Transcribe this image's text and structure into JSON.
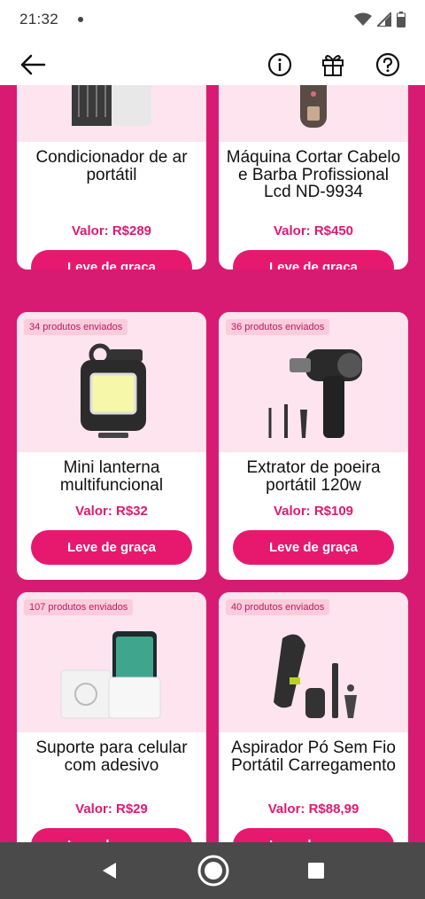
{
  "status_bar": {
    "time": "21:32"
  },
  "products": [
    {
      "title": "Condicionador de ar portátil",
      "price": "Valor: R$289",
      "button": "Leve de graça",
      "badge": "",
      "icon": "air-conditioner-image"
    },
    {
      "title": "Máquina Cortar Cabelo e Barba Profissional Lcd ND-9934",
      "price": "Valor: R$450",
      "button": "Leve de graça",
      "badge": "",
      "icon": "hair-clipper-image"
    },
    {
      "title": "Mini lanterna multifuncional",
      "price": "Valor: R$32",
      "button": "Leve de graça",
      "badge": "34 produtos enviados",
      "icon": "mini-flashlight-image"
    },
    {
      "title": "Extrator de poeira portátil 120w",
      "price": "Valor: R$109",
      "button": "Leve de graça",
      "badge": "36 produtos enviados",
      "icon": "dust-blower-image"
    },
    {
      "title": "Suporte para celular com adesivo",
      "price": "Valor: R$29",
      "button": "Leve de graça",
      "badge": "107 produtos enviados",
      "icon": "phone-holder-image"
    },
    {
      "title": "Aspirador Pó Sem Fio Portátil Carregamento",
      "price": "Valor: R$88,99",
      "button": "Leve de graça",
      "badge": "40 produtos enviados",
      "icon": "cordless-vacuum-image"
    }
  ],
  "colors": {
    "accent": "#e6196f",
    "background": "#d81b72",
    "image_bg": "#fde4ee",
    "badge_bg": "#f9cddc"
  }
}
